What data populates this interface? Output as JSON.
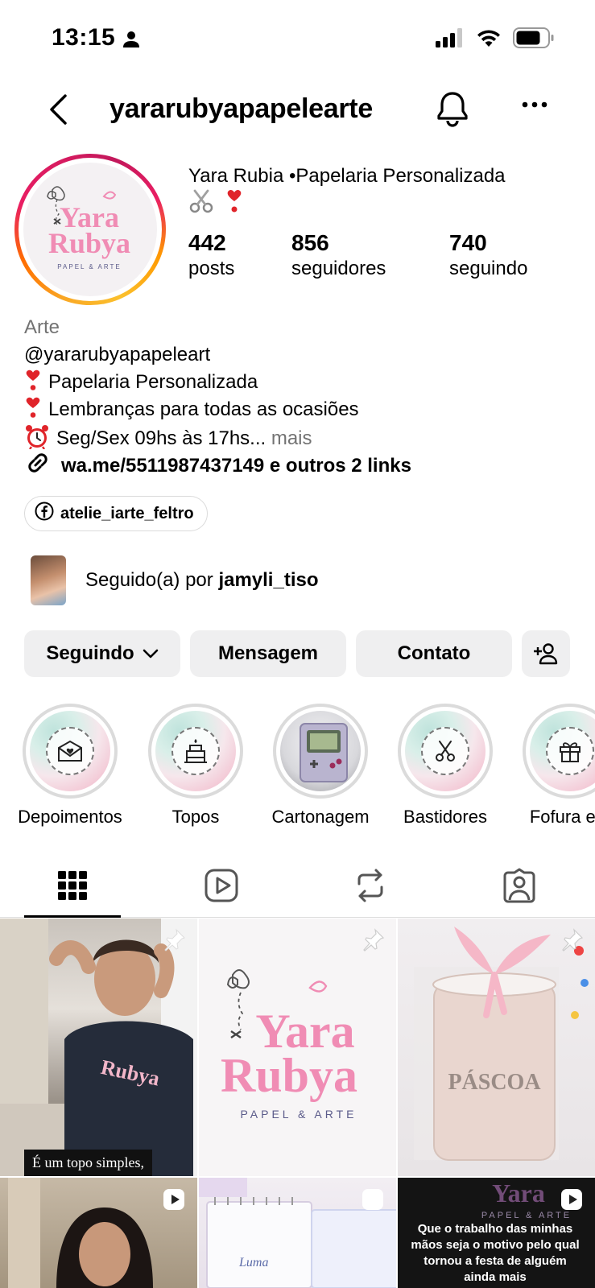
{
  "status_bar": {
    "time": "13:15"
  },
  "nav": {
    "username": "yararubyapapelearte"
  },
  "profile": {
    "display_name": "Yara Rubia •Papelaria Personalizada",
    "stats": [
      {
        "value": "442",
        "label": "posts"
      },
      {
        "value": "856",
        "label": "seguidores"
      },
      {
        "value": "740",
        "label": "seguindo"
      }
    ],
    "avatar_logo": {
      "line1": "Yara",
      "line2": "Rubya",
      "tagline": "PAPEL & ARTE"
    }
  },
  "bio": {
    "category": "Arte",
    "handle": "@yararubyapapeleart",
    "line1": "Papelaria Personalizada",
    "line2": "Lembranças para todas as ocasiões",
    "line3": "Seg/Sex 09hs às 17hs...",
    "more_label": "mais"
  },
  "links": {
    "text": "wa.me/5511987437149 e outros 2 links"
  },
  "facebook_chip": {
    "label": "atelie_iarte_feltro"
  },
  "followed_by": {
    "prefix": "Seguido(a) por ",
    "user": "jamyli_tiso"
  },
  "buttons": {
    "following": "Seguindo",
    "message": "Mensagem",
    "contact": "Contato"
  },
  "highlights": [
    {
      "label": "Depoimentos",
      "icon": "envelope-icon"
    },
    {
      "label": "Topos",
      "icon": "cake-icon"
    },
    {
      "label": "Cartonagem",
      "icon": "game-console-photo"
    },
    {
      "label": "Bastidores",
      "icon": "scissors-icon"
    },
    {
      "label": "Fofura em",
      "icon": "gift-icon"
    }
  ],
  "tabs": [
    "grid-tab",
    "reels-tab",
    "reposts-tab",
    "tagged-tab"
  ],
  "posts": {
    "post1_caption": "É um topo simples,",
    "post2_logo": {
      "line1": "Yara",
      "line2": "Rubya",
      "tagline": "PAPEL & ARTE"
    },
    "post3_text": "PÁSCOA",
    "post6_caption": "Que o trabalho das minhas mãos seja o motivo pelo qual tornou a festa de alguém ainda mais"
  },
  "colors": {
    "brand_pink": "#f08cb4",
    "button_bg": "#efeff0",
    "muted_text": "#737373",
    "link_text": "#000000"
  }
}
